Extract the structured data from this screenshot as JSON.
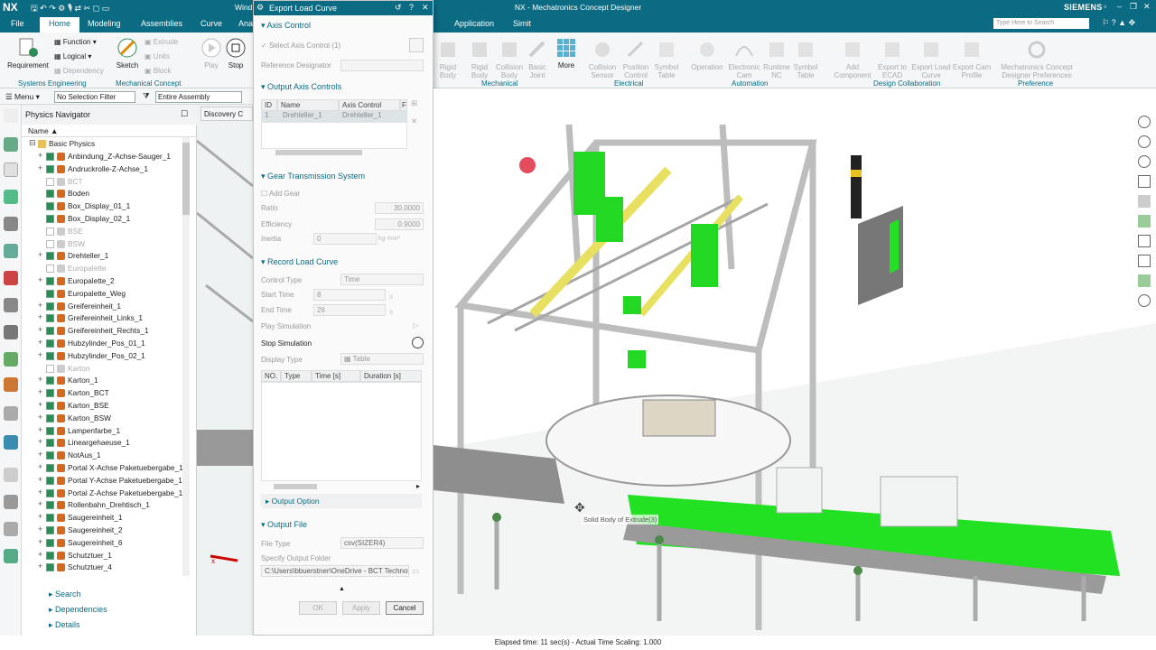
{
  "app": {
    "logo": "NX",
    "title": "NX - Mechatronics Concept Designer",
    "brand": "SIEMENS",
    "window_label": "Wind",
    "search_placeholder": "Type Here to Search"
  },
  "tabs": [
    "File",
    "Home",
    "Modeling",
    "Assemblies",
    "Curve",
    "Ana",
    "Application",
    "Simit"
  ],
  "ribbon": {
    "requirement": "Requirement",
    "function": "Function",
    "logical": "Logical",
    "dependency": "Dependency",
    "sketch": "Sketch",
    "extrude": "Extrude",
    "units": "Units",
    "block": "Block",
    "play": "Play",
    "stop": "Stop",
    "more": "More",
    "mech_items": [
      "Rigid Body",
      "Rigid Body",
      "Collision Body",
      "Basic Joint"
    ],
    "elec_items": [
      "Collision Sensor",
      "Position Control",
      "Symbol Table"
    ],
    "auto_items": [
      "Operation",
      "Electronic Cam",
      "Runtime NC",
      "Symbol Table"
    ],
    "collab_items": [
      "Add Component",
      "Export to ECAD",
      "Export Load Curve",
      "Export Cam Profile"
    ],
    "pref_item": "Mechatronics Concept Designer Preferences",
    "groups": [
      "Systems Engineering",
      "Mechanical Concept",
      "Mechanical",
      "Electrical",
      "Automation",
      "Design Collaboration",
      "Preference"
    ]
  },
  "toolbar2": {
    "menu": "Menu",
    "filter": "No Selection Filter",
    "assembly": "Entire Assembly"
  },
  "navigator": {
    "title": "Physics Navigator",
    "col_name": "Name",
    "root": "Basic Physics",
    "tab": "Discovery C",
    "items": [
      {
        "label": "Anbindung_Z-Achse-Sauger_1",
        "on": true,
        "exp": true
      },
      {
        "label": "Andruckrolle-Z-Achse_1",
        "on": true,
        "exp": true
      },
      {
        "label": "BCT",
        "on": false,
        "exp": false
      },
      {
        "label": "Boden",
        "on": true,
        "exp": false
      },
      {
        "label": "Box_Display_01_1",
        "on": true,
        "exp": false
      },
      {
        "label": "Box_Display_02_1",
        "on": true,
        "exp": false
      },
      {
        "label": "BSE",
        "on": false,
        "exp": false
      },
      {
        "label": "BSW",
        "on": false,
        "exp": false
      },
      {
        "label": "Drehteller_1",
        "on": true,
        "exp": true
      },
      {
        "label": "Europalette",
        "on": false,
        "exp": false
      },
      {
        "label": "Europalette_2",
        "on": true,
        "exp": true
      },
      {
        "label": "Europalette_Weg",
        "on": true,
        "exp": false
      },
      {
        "label": "Greifereinheit_1",
        "on": true,
        "exp": true
      },
      {
        "label": "Greifereinheit_Links_1",
        "on": true,
        "exp": true
      },
      {
        "label": "Greifereinheit_Rechts_1",
        "on": true,
        "exp": true
      },
      {
        "label": "Hubzylinder_Pos_01_1",
        "on": true,
        "exp": true
      },
      {
        "label": "Hubzylinder_Pos_02_1",
        "on": true,
        "exp": true
      },
      {
        "label": "Karton",
        "on": false,
        "exp": false
      },
      {
        "label": "Karton_1",
        "on": true,
        "exp": true
      },
      {
        "label": "Karton_BCT",
        "on": true,
        "exp": true
      },
      {
        "label": "Karton_BSE",
        "on": true,
        "exp": true
      },
      {
        "label": "Karton_BSW",
        "on": true,
        "exp": true
      },
      {
        "label": "Lampenfarbe_1",
        "on": true,
        "exp": true
      },
      {
        "label": "Lineargehaeuse_1",
        "on": true,
        "exp": true
      },
      {
        "label": "NotAus_1",
        "on": true,
        "exp": true
      },
      {
        "label": "Portal X-Achse Paketuebergabe_1",
        "on": true,
        "exp": true
      },
      {
        "label": "Portal Y-Achse Paketuebergabe_1",
        "on": true,
        "exp": true
      },
      {
        "label": "Portal Z-Achse Paketuebergabe_1",
        "on": true,
        "exp": true
      },
      {
        "label": "Rollenbahn_Drehtisch_1",
        "on": true,
        "exp": true
      },
      {
        "label": "Saugereinheit_1",
        "on": true,
        "exp": true
      },
      {
        "label": "Saugereinheit_2",
        "on": true,
        "exp": true
      },
      {
        "label": "Saugereinheit_6",
        "on": true,
        "exp": true
      },
      {
        "label": "Schutztuer_1",
        "on": true,
        "exp": true
      },
      {
        "label": "Schutztuer_4",
        "on": true,
        "exp": true
      }
    ],
    "search": "Search",
    "dependencies": "Dependencies",
    "details": "Details"
  },
  "dialog": {
    "title": "Export Load Curve",
    "axis_control": "Axis Control",
    "select_axis": "Select Axis Control (1)",
    "ref_designator": "Reference Designator",
    "output_axis": "Output Axis Controls",
    "col_id": "ID",
    "col_name": "Name",
    "col_axis": "Axis Control",
    "col_f": "F",
    "row_id": "1",
    "row_name": "Drehteller_1",
    "row_axis": "Drehteller_1",
    "gear": "Gear Transmission System",
    "add_gear": "Add Gear",
    "ratio": "Ratio",
    "ratio_v": "30.0000",
    "efficiency": "Efficiency",
    "efficiency_v": "0.9000",
    "inertia": "Inertia",
    "inertia_v": "0",
    "inertia_unit": "kg·mm²",
    "record": "Record Load Curve",
    "control_type": "Control Type",
    "control_type_v": "Time",
    "start_time": "Start Time",
    "start_v": "8",
    "end_time": "End Time",
    "end_v": "26",
    "unit_s": "s",
    "play_sim": "Play Simulation",
    "stop_sim": "Stop Simulation",
    "display_type": "Display Type",
    "display_v": "Table",
    "t_no": "NO.",
    "t_type": "Type",
    "t_time": "Time [s]",
    "t_dur": "Duration [s]",
    "output_option": "Output Option",
    "output_file": "Output File",
    "file_type": "File Type",
    "file_type_v": "csv(SIZER4)",
    "folder": "Specify Output Folder",
    "folder_v": "C:\\Users\\bbuerstner\\OneDrive - BCT Technol",
    "ok": "OK",
    "apply": "Apply",
    "cancel": "Cancel"
  },
  "viewport": {
    "tooltip": "Solid Body of Extrude(3)"
  },
  "status": "Elapsed time: 11 sec(s) - Actual Time Scaling: 1.000",
  "colors": {
    "teal": "#0b6b82",
    "green": "#22e022",
    "frame": "#c9c9c9"
  }
}
